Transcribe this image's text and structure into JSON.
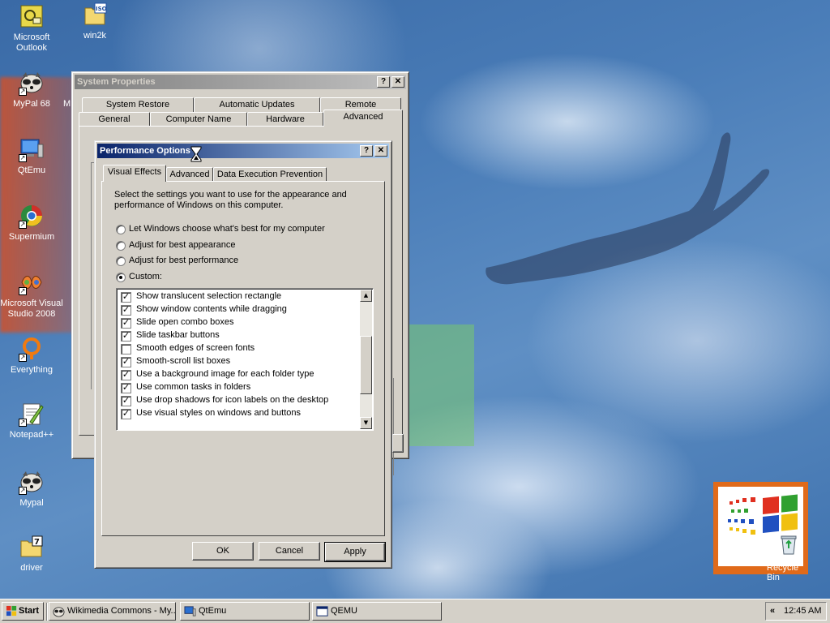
{
  "desktop": {
    "icons": [
      {
        "label": "Microsoft Outlook",
        "icon": "outlook-icon"
      },
      {
        "label": "win2k",
        "icon": "iso-file-icon"
      },
      {
        "label": "MyPal 68",
        "icon": "raccoon-icon"
      },
      {
        "label": "M",
        "icon": "truncated-label"
      },
      {
        "label": "QtEmu",
        "icon": "computer-icon"
      },
      {
        "label": "Supermium",
        "icon": "browser-icon"
      },
      {
        "label": "Microsoft Visual Studio 2008",
        "icon": "visual-studio-icon"
      },
      {
        "label": "Everything",
        "icon": "search-icon"
      },
      {
        "label": "Notepad++",
        "icon": "notepad-icon"
      },
      {
        "label": "Mypal",
        "icon": "raccoon-icon"
      },
      {
        "label": "driver",
        "icon": "folder-7z-icon"
      },
      {
        "label": "Recycle Bin",
        "icon": "recycle-bin-icon"
      }
    ]
  },
  "system_properties": {
    "title": "System Properties",
    "help_btn": "?",
    "close_btn": "✕",
    "tabs_row1": [
      "System Restore",
      "Automatic Updates",
      "Remote"
    ],
    "tabs_row2": [
      "General",
      "Computer Name",
      "Hardware",
      "Advanced"
    ],
    "selected_tab": "Advanced"
  },
  "performance_options": {
    "title": "Performance Options",
    "help_btn": "?",
    "close_btn": "✕",
    "tabs": [
      "Visual Effects",
      "Advanced",
      "Data Execution Prevention"
    ],
    "selected_tab": "Visual Effects",
    "description": "Select the settings you want to use for the appearance and performance of Windows on this computer.",
    "radios": [
      {
        "label": "Let Windows choose what's best for my computer",
        "selected": false
      },
      {
        "label": "Adjust for best appearance",
        "selected": false
      },
      {
        "label": "Adjust for best performance",
        "selected": false
      },
      {
        "label": "Custom:",
        "selected": true
      }
    ],
    "effects": [
      {
        "label": "Show translucent selection rectangle",
        "checked": true
      },
      {
        "label": "Show window contents while dragging",
        "checked": true
      },
      {
        "label": "Slide open combo boxes",
        "checked": true
      },
      {
        "label": "Slide taskbar buttons",
        "checked": true
      },
      {
        "label": "Smooth edges of screen fonts",
        "checked": false
      },
      {
        "label": "Smooth-scroll list boxes",
        "checked": true
      },
      {
        "label": "Use a background image for each folder type",
        "checked": true
      },
      {
        "label": "Use common tasks in folders",
        "checked": true
      },
      {
        "label": "Use drop shadows for icon labels on the desktop",
        "checked": true
      },
      {
        "label": "Use visual styles on windows and buttons",
        "checked": true
      }
    ],
    "scroll_position": 0.6,
    "buttons": {
      "ok": "OK",
      "cancel": "Cancel",
      "apply": "Apply"
    }
  },
  "taskbar": {
    "start_label": "Start",
    "tasks": [
      {
        "label": "Wikimedia Commons - My...",
        "icon": "browser-icon"
      },
      {
        "label": "QtEmu",
        "icon": "computer-icon"
      },
      {
        "label": "QEMU",
        "icon": "window-icon"
      }
    ],
    "tray_arrow": "«",
    "clock": "12:45 AM"
  },
  "colors": {
    "desktop_blue": "#3d6ea8",
    "title_active_start": "#0a246a",
    "title_active_end": "#a6caf0",
    "face": "#d4d0c8"
  }
}
